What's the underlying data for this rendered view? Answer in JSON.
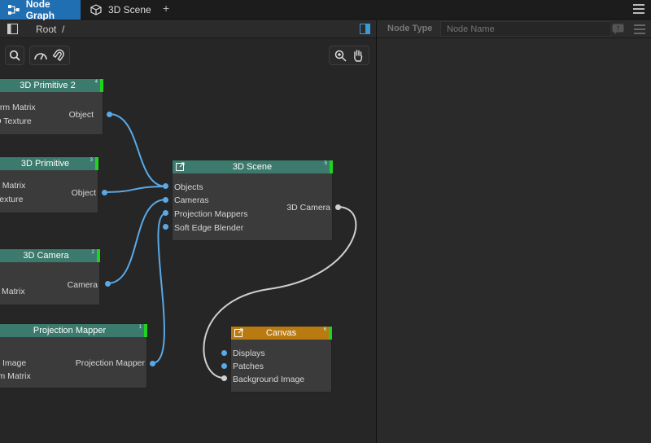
{
  "tabs": [
    {
      "label": "Node Graph",
      "icon": "node-graph-icon",
      "active": true
    },
    {
      "label": "3D Scene",
      "icon": "cube-icon",
      "active": false
    }
  ],
  "new_tab_label": "+",
  "breadcrumb": {
    "root": "Root",
    "separator": "/"
  },
  "panel": {
    "node_type_label": "Node Type",
    "node_name_placeholder": "Node Name"
  },
  "nodes": {
    "primitive2": {
      "title": "3D Primitive 2",
      "num": "4",
      "inputs": [
        "orm Matrix",
        "D Texture"
      ],
      "output": "Object"
    },
    "primitive": {
      "title": "3D Primitive",
      "num": "3",
      "inputs": [
        "n Matrix",
        " Texture"
      ],
      "output": "Object"
    },
    "camera": {
      "title": "3D Camera",
      "num": "2",
      "inputs": [
        "Matrix"
      ],
      "output": "Camera"
    },
    "projection": {
      "title": "Projection Mapper",
      "num": "1",
      "inputs": [
        "Image",
        "rm Matrix"
      ],
      "output": "Projection Mapper"
    },
    "scene": {
      "title": "3D Scene",
      "num": "5",
      "inputs": [
        "Objects",
        "Cameras",
        "Projection Mappers",
        "Soft Edge Blender"
      ],
      "output": "3D Camera"
    },
    "canvas": {
      "title": "Canvas",
      "num": "6",
      "inputs": [
        "Displays",
        "Patches",
        "Background Image"
      ]
    }
  },
  "colors": {
    "accent": "#1f6fb2",
    "node_header": "#3b7a6c",
    "canvas_header": "#b97a12",
    "flag": "#21d321",
    "wire": "#5aa9e6"
  }
}
